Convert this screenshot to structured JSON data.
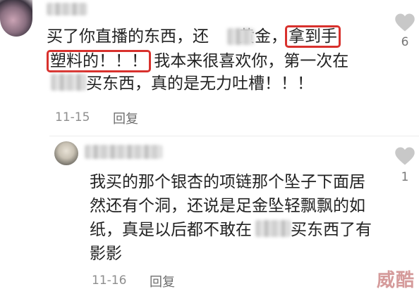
{
  "comments": [
    {
      "lines": [
        {
          "parts": [
            "买了你直播的东西，还",
            "黄金，"
          ],
          "highlight": "拿到手"
        },
        {
          "highlight": "塑料的！！！",
          "after": " 我本来很喜欢你，第一次在"
        },
        {
          "after": "买东西，真的是无力吐槽！！！"
        }
      ],
      "date": "11-15",
      "reply_label": "回复",
      "likes": "6"
    },
    {
      "lines": [
        "我买的那个银杏的项链那个坠子下面居",
        "然还有个洞，还说是足金坠轻飘飘的如",
        "纸，真是以后都不敢在",
        "买东西了有",
        "影影"
      ],
      "date": "11-16",
      "reply_label": "回复",
      "likes": "1"
    }
  ],
  "watermark": "威酷",
  "colors": {
    "highlight_border": "#d8312d",
    "meta_text": "#8e8e8e",
    "heart": "#c8c8c8"
  }
}
